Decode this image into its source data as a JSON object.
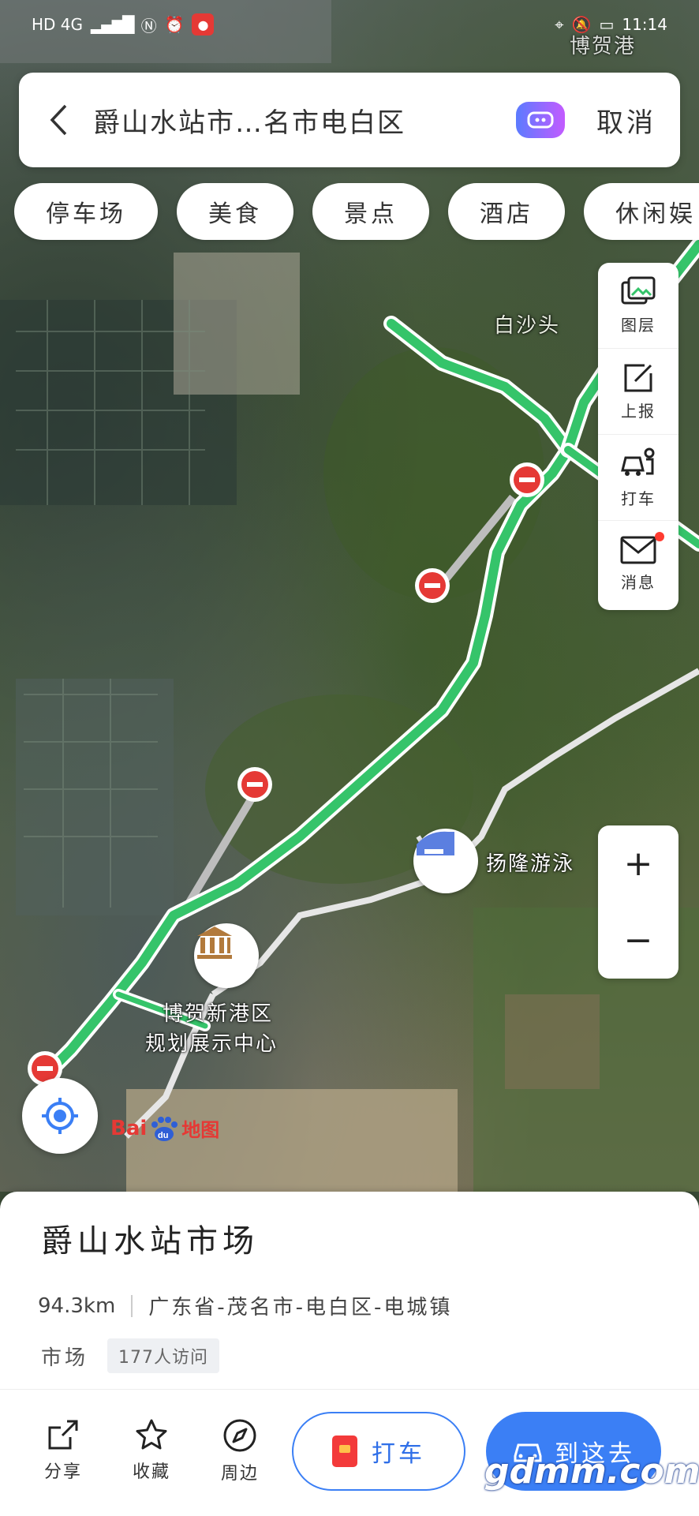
{
  "status_bar": {
    "left_text": "HD 4G",
    "signal": "▂▄▆█",
    "time": "11:14"
  },
  "search": {
    "query": "爵山水站市…名市电白区",
    "cancel_label": "取消"
  },
  "chips": [
    "停车场",
    "美食",
    "景点",
    "酒店",
    "休闲娱"
  ],
  "tools": [
    {
      "label": "图层",
      "icon": "layers-icon"
    },
    {
      "label": "上报",
      "icon": "report-icon"
    },
    {
      "label": "打车",
      "icon": "taxi-icon"
    },
    {
      "label": "消息",
      "icon": "mail-icon"
    }
  ],
  "zoom": {
    "plus": "+",
    "minus": "−"
  },
  "map_labels": {
    "village": "白沙头",
    "swim": "扬隆游泳",
    "hall_line1": "博贺新港区",
    "hall_line2": "规划展示中心",
    "top_right": "博贺港"
  },
  "logo": {
    "bai": "Bai",
    "du": "du",
    "ditu": "地图"
  },
  "place": {
    "title": "爵山水站市场",
    "distance": "94.3km",
    "address": "广东省-茂名市-电白区-电城镇",
    "category": "市场",
    "visits": "177人访问"
  },
  "actions": {
    "share": "分享",
    "favorite": "收藏",
    "nearby": "周边",
    "taxi": "打车",
    "go_here": "到这去"
  },
  "watermark": "gdmm.com",
  "colors": {
    "accent_blue": "#3b7ff5",
    "route_green": "#35c46a",
    "restriction_red": "#e53935"
  }
}
